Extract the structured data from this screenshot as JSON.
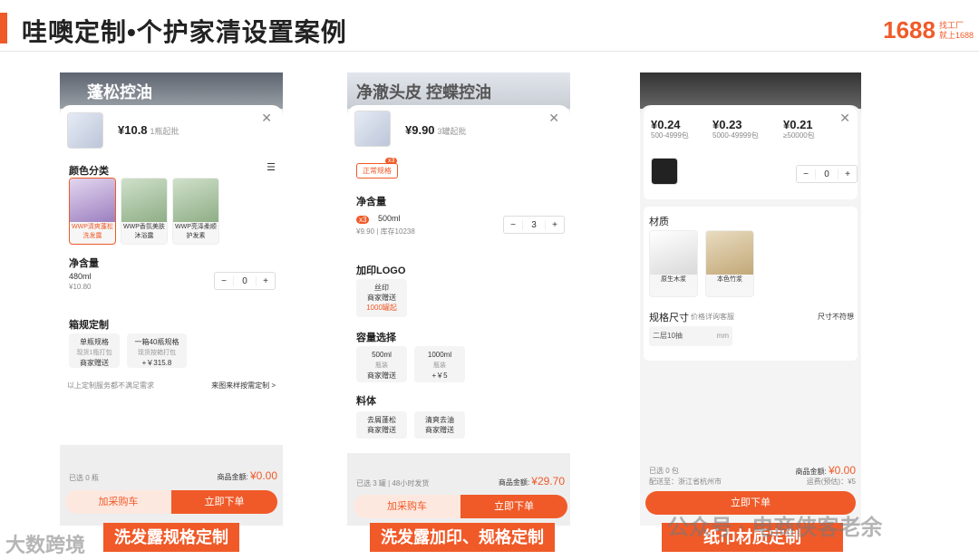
{
  "slide_title": "哇噢定制•个护家清设置案例",
  "logo": {
    "num": "1688",
    "sub1": "找工厂",
    "sub2": "就上1688"
  },
  "captions": [
    "洗发露规格定制",
    "洗发露加印、规格定制",
    "纸巾材质定制"
  ],
  "watermarks": {
    "left": "大数跨境",
    "right": "公众号 · 电商侠客老余"
  },
  "phone1": {
    "header_title": "蓬松控油",
    "price_symbol": "¥",
    "price": "10.8",
    "moq": "1瓶起批",
    "color_label": "颜色分类",
    "swatches": [
      "WWP清爽蓬松洗发露",
      "WWP香氛美肤沐浴露",
      "WWP亮泽柔顺护发素"
    ],
    "net_label": "净含量",
    "net_size": "480ml",
    "net_price": "¥10.80",
    "qty": "0",
    "box_label": "箱规定制",
    "box_opt1_a": "单瓶规格",
    "box_opt1_b": "现货1瓶打包",
    "box_opt1_c": "商家赠送",
    "box_opt2_a": "一箱40瓶规格",
    "box_opt2_b": "现货按箱打包",
    "box_opt2_c": "+￥315.8",
    "note": "以上定制服务都不满足需求",
    "note_link": "来图来样按需定制 >",
    "selected": "已选 0 瓶",
    "total_label": "商品金额:",
    "total": "¥0.00",
    "cart": "加采购车",
    "buy": "立即下单"
  },
  "phone2": {
    "header_title": "净澈头皮 控蝶控油",
    "price_symbol": "¥",
    "price": "9.90",
    "moq": "3罐起批",
    "tag": "正常规格",
    "tag_badge": "x3",
    "net_label": "净含量",
    "net_badge": "x3",
    "net_size": "500ml",
    "net_price": "¥9.90",
    "stock": "库存10238",
    "qty": "3",
    "logo_label": "加印LOGO",
    "logo_a": "丝印",
    "logo_b": "商家赠送",
    "logo_c": "1000罐起",
    "cap_label": "容量选择",
    "cap1_a": "500ml",
    "cap1_b": "瓶装",
    "cap1_c": "商家赠送",
    "cap2_a": "1000ml",
    "cap2_b": "瓶装",
    "cap2_c": "+￥5",
    "mat_label": "料体",
    "mat1_a": "去屑蓬松",
    "mat1_b": "商家赠送",
    "mat2_a": "清爽去油",
    "mat2_b": "商家赠送",
    "selected": "已选 3 罐 | 48小时发货",
    "total_label": "商品金额:",
    "total": "¥29.70",
    "cart": "加采购车",
    "buy": "立即下单"
  },
  "phone3": {
    "tiers": [
      {
        "price": "¥0.24",
        "range": "500-4999包"
      },
      {
        "price": "¥0.23",
        "range": "5000-49999包"
      },
      {
        "price": "¥0.21",
        "range": "≥50000包"
      }
    ],
    "qty": "0",
    "mat_label": "材质",
    "mat1": "原生木浆",
    "mat2": "本色竹浆",
    "size_label": "规格尺寸",
    "size_hint": "价格详询客服",
    "size_link": "尺寸不符想",
    "size_input": "二层10抽",
    "size_unit": "mm",
    "selected": "已选 0 包",
    "ship": "配送至：浙江省杭州市",
    "total_label": "商品金额:",
    "total": "¥0.00",
    "freight": "运费(预估)：¥5",
    "buy": "立即下单"
  }
}
